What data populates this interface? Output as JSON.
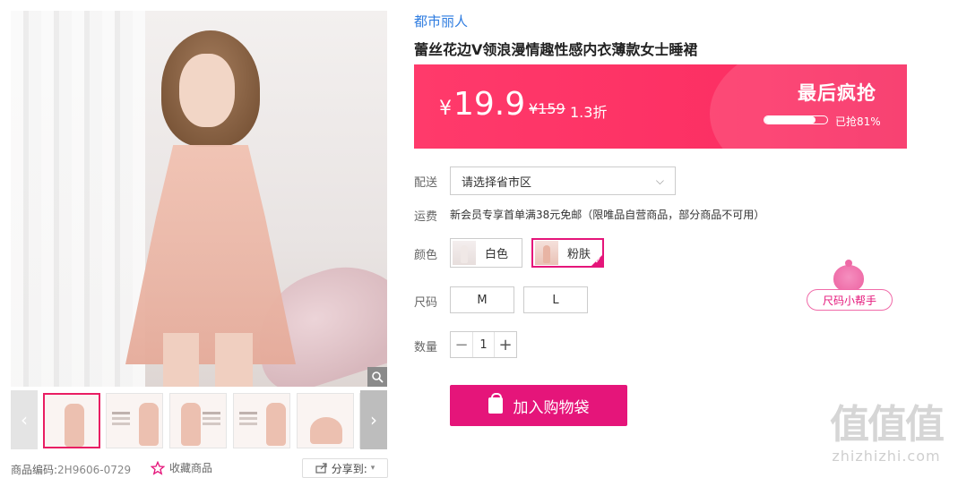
{
  "gallery": {
    "main_alt": "product-photo",
    "thumbnail_count": 6,
    "prev_arrow": "‹",
    "next_arrow": "›"
  },
  "sku": {
    "label": "商品编码:",
    "code": "2H9606-0729"
  },
  "favorite": {
    "label": "收藏商品",
    "icon": "star-icon"
  },
  "share": {
    "label": "分享到:"
  },
  "product": {
    "brand": "都市丽人",
    "title": "蕾丝花边V领浪漫情趣性感内衣薄款女士睡裙"
  },
  "price": {
    "currency": "¥",
    "current": "19.9",
    "original": "¥159",
    "discount": "1.3折",
    "flash_label": "最后疯抢",
    "sold_percent": 0.81,
    "sold_text": "已抢81%",
    "banner_color": "#fc2f63"
  },
  "shipping": {
    "label": "配送",
    "select_value": "请选择省市区"
  },
  "freight": {
    "label": "运费",
    "text": "新会员专享首单满38元免邮（限唯品自营商品，部分商品不可用）"
  },
  "color": {
    "label": "颜色",
    "options": [
      {
        "name": "白色",
        "selected": false
      },
      {
        "name": "粉肤",
        "selected": true
      }
    ]
  },
  "size": {
    "label": "尺码",
    "options": [
      "M",
      "L"
    ],
    "helper": "尺码小帮手"
  },
  "quantity": {
    "label": "数量",
    "value": "1",
    "minus": "−",
    "plus": "+"
  },
  "cart": {
    "button_label": "加入购物袋",
    "color": "#e5157a"
  },
  "watermark": {
    "logo": "值值值",
    "site": "zhizhizhi.com"
  }
}
